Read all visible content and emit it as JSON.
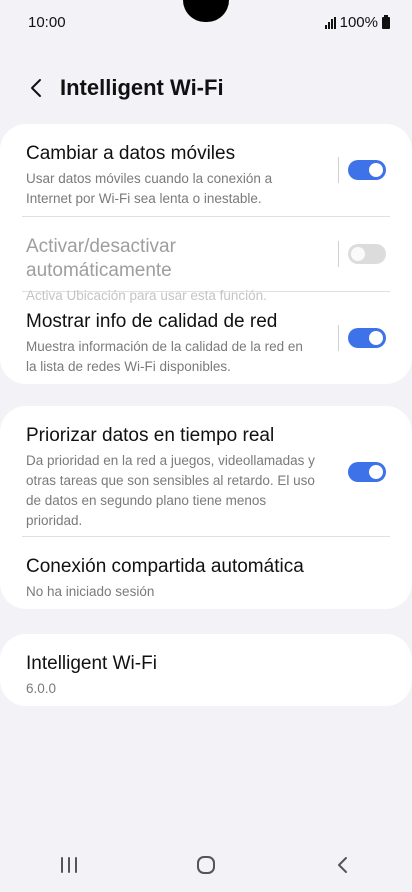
{
  "status": {
    "time": "10:00",
    "battery": "100%"
  },
  "header": {
    "title": "Intelligent Wi-Fi"
  },
  "section1": [
    {
      "label": "Cambiar a datos móviles",
      "desc": "Usar datos móviles cuando la conexión a Internet por Wi-Fi sea lenta o inestable.",
      "on": true,
      "enabled": true
    },
    {
      "label": "Activar/desactivar automáticamente",
      "desc": "Activa Ubicación para usar esta función.",
      "on": false,
      "enabled": false
    },
    {
      "label": "Mostrar info de calidad de red",
      "desc": "Muestra información de la calidad de la red en la lista de redes Wi-Fi disponibles.",
      "on": true,
      "enabled": true
    }
  ],
  "section2": [
    {
      "label": "Priorizar datos en tiempo real",
      "desc": "Da prioridad en la red a juegos, videollamadas y otras tareas que son sensibles al retardo. El uso de datos en segundo plano tiene menos prioridad.",
      "on": true
    },
    {
      "label": "Conexión compartida automática",
      "desc": "No ha iniciado sesión"
    }
  ],
  "section3": {
    "label": "Intelligent Wi-Fi",
    "desc": "6.0.0"
  },
  "icons": {
    "back": "chevron-left-icon",
    "recents": "recents-icon",
    "home": "home-icon",
    "nav_back": "nav-back-icon"
  },
  "colors": {
    "accent": "#3e72e8",
    "background": "#f2f2f7"
  }
}
